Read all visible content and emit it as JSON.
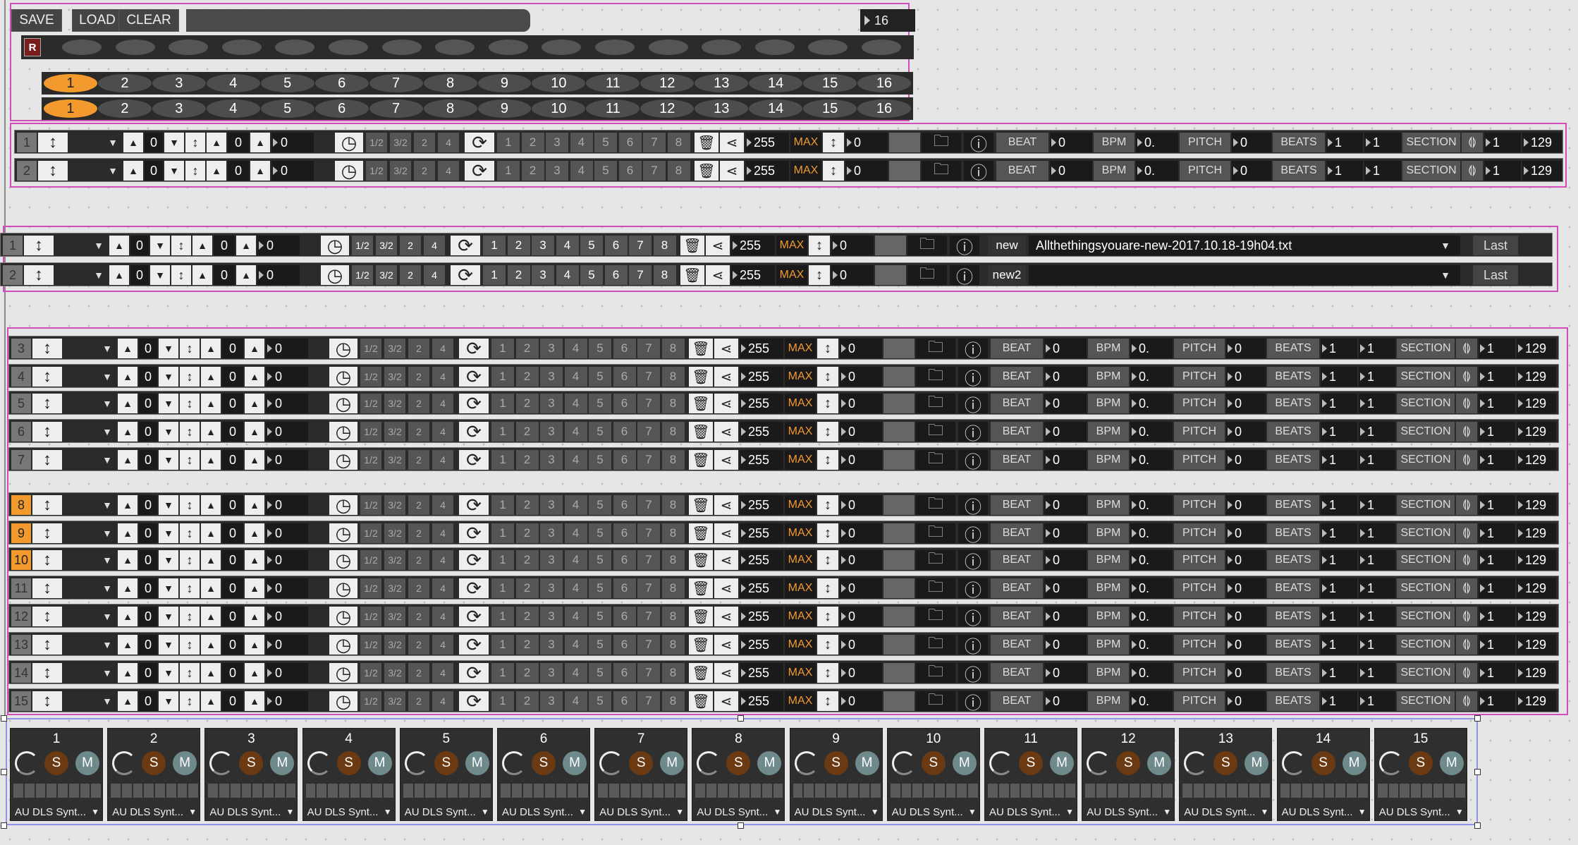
{
  "toolbar": {
    "save": "SAVE",
    "load": "LOAD",
    "clear": "CLEAR",
    "count": "16",
    "record": "R"
  },
  "steps": [
    "1",
    "2",
    "3",
    "4",
    "5",
    "6",
    "7",
    "8",
    "9",
    "10",
    "11",
    "12",
    "13",
    "14",
    "15",
    "16"
  ],
  "divisions": [
    "1/2",
    "3/2",
    "2",
    "4"
  ],
  "step_buttons": [
    "1",
    "2",
    "3",
    "4",
    "5",
    "6",
    "7",
    "8"
  ],
  "labels": {
    "beat": "BEAT",
    "bpm": "BPM",
    "pitch": "PITCH",
    "beats": "BEATS",
    "section": "SECTION",
    "max": "MAX",
    "last": "Last"
  },
  "values": {
    "zero": "0",
    "vol": "255",
    "bpm": "0.",
    "one": "1",
    "end": "129"
  },
  "tracks_top": [
    {
      "n": "1"
    },
    {
      "n": "2"
    }
  ],
  "tracks_file": [
    {
      "n": "1",
      "name": "new",
      "file": "Allthethingsyouare-new-2017.10.18-19h04.txt"
    },
    {
      "n": "2",
      "name": "new2",
      "file": ""
    }
  ],
  "tracks_main": [
    {
      "n": "3"
    },
    {
      "n": "4"
    },
    {
      "n": "5"
    },
    {
      "n": "6"
    },
    {
      "n": "7"
    },
    {
      "n": "8"
    },
    {
      "n": "9"
    },
    {
      "n": "10"
    },
    {
      "n": "11"
    },
    {
      "n": "12"
    },
    {
      "n": "13"
    },
    {
      "n": "14"
    },
    {
      "n": "15"
    }
  ],
  "mixer": {
    "solo": "S",
    "mute": "M",
    "instrument": "AU DLS Synt...",
    "channels": [
      "1",
      "2",
      "3",
      "4",
      "5",
      "6",
      "7",
      "8",
      "9",
      "10",
      "11",
      "12",
      "13",
      "14",
      "15"
    ]
  },
  "icons": {
    "arrows": "vertical-arrows-icon",
    "clock": "clock-icon",
    "loop": "loop-icon",
    "folder": "folder-icon",
    "info": "info-icon"
  },
  "colors": {
    "accent": "#f29a2e",
    "group_border": "#d24dbc",
    "mixer_border": "#8f95e4",
    "solo": "#6b3a12",
    "mute": "#6e8a8b"
  }
}
